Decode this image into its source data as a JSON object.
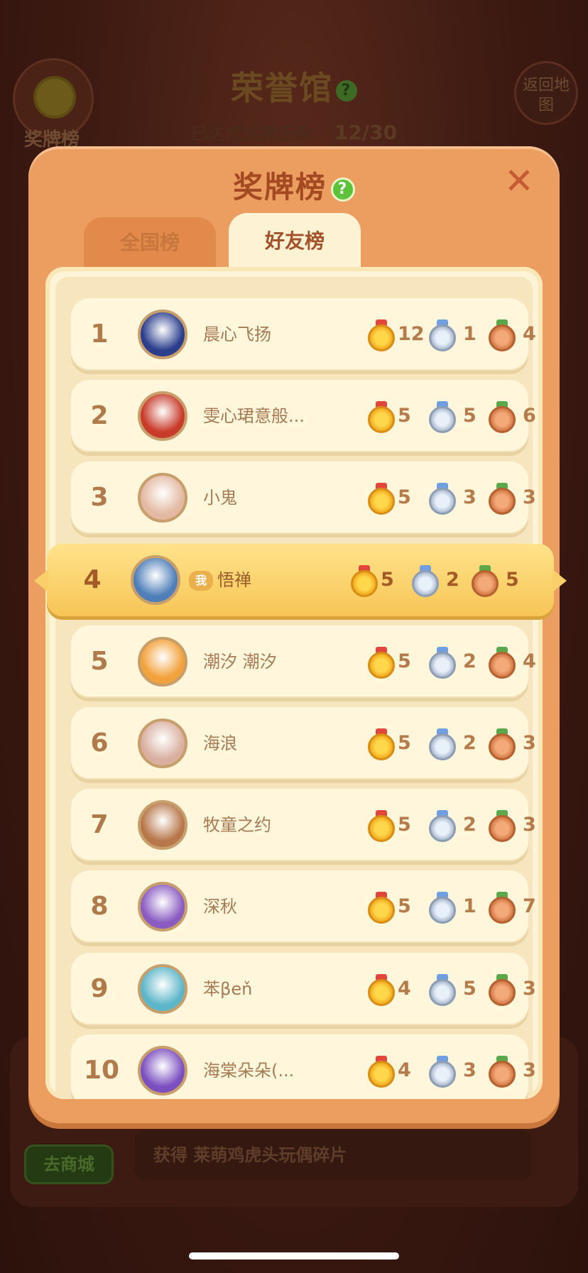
{
  "background": {
    "title": "荣誉馆",
    "progress_label": "已达成奖牌任务：",
    "progress_value": "12/30",
    "medal_button_label": "奖牌榜",
    "back_button_label": "返回地图",
    "reward_text": "获得 莱萌鸡虎头玩偶碎片",
    "shop_button_label": "去商城"
  },
  "modal": {
    "title": "奖牌榜",
    "help": "?",
    "close": "✕",
    "tabs": [
      {
        "label": "全国榜",
        "active": false
      },
      {
        "label": "好友榜",
        "active": true
      }
    ],
    "me_badge": "我"
  },
  "colors": {
    "modal_bg": "#eb9e60",
    "panel_bg": "#fdf3d6",
    "highlight_row": "#f7c556",
    "gold": "#f0a81c",
    "silver": "#aab8cc",
    "bronze": "#d07744"
  },
  "rankings": [
    {
      "rank": "1",
      "name": "晨心飞扬",
      "gold": "12",
      "silver": "1",
      "bronze": "4",
      "avatar_color": "#2b3e8c",
      "is_me": false
    },
    {
      "rank": "2",
      "name": "雯心珺意般...",
      "gold": "5",
      "silver": "5",
      "bronze": "6",
      "avatar_color": "#c83a2a",
      "is_me": false
    },
    {
      "rank": "3",
      "name": "小鬼",
      "gold": "5",
      "silver": "3",
      "bronze": "3",
      "avatar_color": "#e3b9a3",
      "is_me": false
    },
    {
      "rank": "4",
      "name": "悟禅",
      "gold": "5",
      "silver": "2",
      "bronze": "5",
      "avatar_color": "#4f7fb8",
      "is_me": true
    },
    {
      "rank": "5",
      "name": "潮汐 潮汐",
      "gold": "5",
      "silver": "2",
      "bronze": "4",
      "avatar_color": "#f2a23a",
      "is_me": false
    },
    {
      "rank": "6",
      "name": "海浪",
      "gold": "5",
      "silver": "2",
      "bronze": "3",
      "avatar_color": "#d9b0a0",
      "is_me": false
    },
    {
      "rank": "7",
      "name": "牧童之约",
      "gold": "5",
      "silver": "2",
      "bronze": "3",
      "avatar_color": "#b7774a",
      "is_me": false
    },
    {
      "rank": "8",
      "name": "深秋",
      "gold": "5",
      "silver": "1",
      "bronze": "7",
      "avatar_color": "#8a5cc2",
      "is_me": false
    },
    {
      "rank": "9",
      "name": "苯βeň",
      "gold": "4",
      "silver": "5",
      "bronze": "3",
      "avatar_color": "#5db6c8",
      "is_me": false
    },
    {
      "rank": "10",
      "name": "海棠朵朵(...",
      "gold": "4",
      "silver": "3",
      "bronze": "3",
      "avatar_color": "#7b4fc0",
      "is_me": false
    }
  ]
}
